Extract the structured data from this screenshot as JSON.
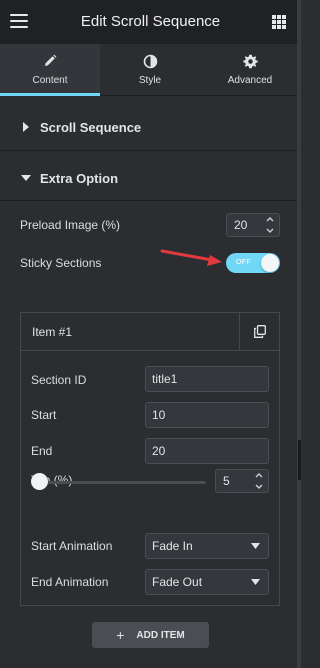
{
  "header": {
    "title": "Edit Scroll Sequence"
  },
  "tabs": [
    {
      "label": "Content",
      "icon": "pencil-icon",
      "active": true
    },
    {
      "label": "Style",
      "icon": "half-circle-icon",
      "active": false
    },
    {
      "label": "Advanced",
      "icon": "gear-icon",
      "active": false
    }
  ],
  "sections": {
    "scroll_sequence": {
      "label": "Scroll Sequence",
      "expanded": false
    },
    "extra_option": {
      "label": "Extra Option",
      "expanded": true
    }
  },
  "preload": {
    "label": "Preload Image (%)",
    "value": "20"
  },
  "sticky": {
    "label": "Sticky Sections",
    "toggle_text": "OFF"
  },
  "item": {
    "title": "Item #1",
    "section_id": {
      "label": "Section ID",
      "value": "title1"
    },
    "start": {
      "label": "Start",
      "value": "10"
    },
    "end": {
      "label": "End",
      "value": "20"
    },
    "top": {
      "label": "Top (%)",
      "value": "5",
      "slider_fraction": 0
    },
    "start_animation": {
      "label": "Start Animation",
      "value": "Fade In"
    },
    "end_animation": {
      "label": "End Animation",
      "value": "Fade Out"
    }
  },
  "add_item": {
    "label": "ADD ITEM"
  },
  "colors": {
    "accent": "#71d7f7",
    "panel": "#2b2d30",
    "header": "#1f2124",
    "arrow": "#e2393f"
  }
}
